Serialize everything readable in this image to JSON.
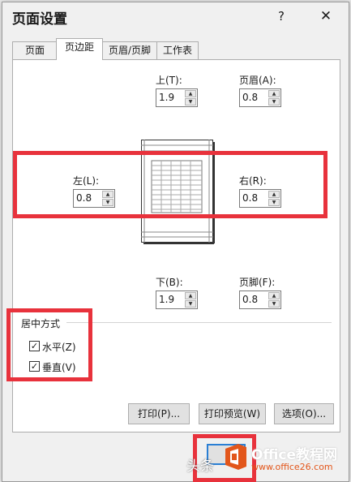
{
  "dialog": {
    "title": "页面设置",
    "help": "?",
    "close": "✕"
  },
  "tabs": [
    "页面",
    "页边距",
    "页眉/页脚",
    "工作表"
  ],
  "active_tab": "页边距",
  "margins": {
    "top": {
      "label": "上(T):",
      "value": "1.9"
    },
    "header": {
      "label": "页眉(A):",
      "value": "0.8"
    },
    "left": {
      "label": "左(L):",
      "value": "0.8"
    },
    "right": {
      "label": "右(R):",
      "value": "0.8"
    },
    "bottom": {
      "label": "下(B):",
      "value": "1.9"
    },
    "footer": {
      "label": "页脚(F):",
      "value": "0.8"
    }
  },
  "centering": {
    "title": "居中方式",
    "horizontal": {
      "label": "水平(Z)",
      "checked": true
    },
    "vertical": {
      "label": "垂直(V)",
      "checked": true
    }
  },
  "buttons": {
    "print": "打印(P)...",
    "preview": "打印预览(W)",
    "options": "选项(O)..."
  },
  "watermark": {
    "brand": "Office教程网",
    "url": "www.office26.com",
    "prefix": "头条"
  },
  "colors": {
    "highlight": "#e8323c",
    "office_orange": "#e2561b"
  }
}
